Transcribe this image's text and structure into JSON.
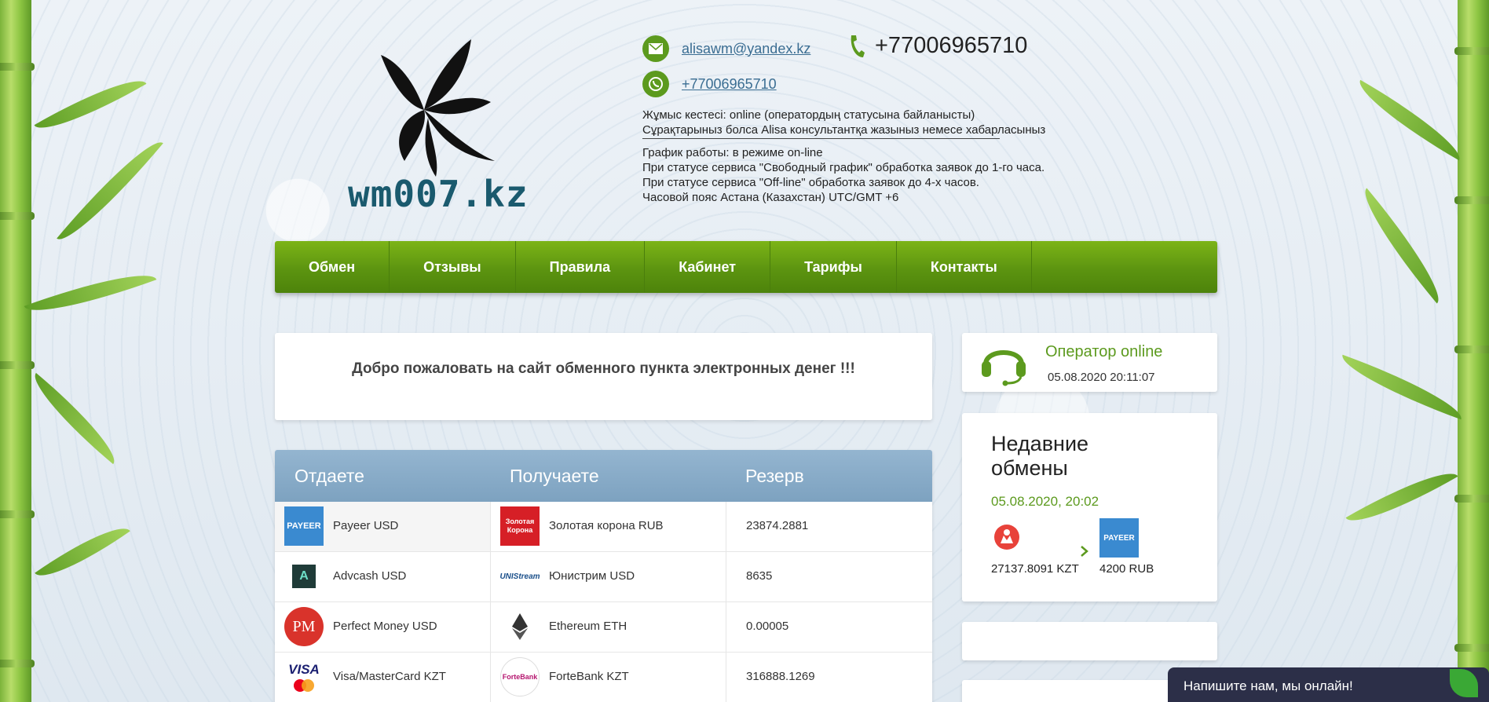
{
  "site": {
    "logo_text": "wm007.kz",
    "email": "alisawm@yandex.kz",
    "phone_big": "+77006965710",
    "whatsapp": "+77006965710"
  },
  "info": {
    "kz_line1": "Жұмыс кестесі: online (оператордың статусына байланысты)",
    "kz_line2": "Сұрақтарыныз болса Alisa консультантқа жазыныз немесе хабарласыныз",
    "ru_line1": "График работы: в режиме on-line",
    "ru_line2": "При статусе сервиса \"Свободный график\" обработка заявок до 1-го часа.",
    "ru_line3": "При статусе сервиса \"Off-line\" обработка заявок до 4-х часов.",
    "ru_line4": "Часовой пояс Астана (Казахстан) UTC/GMT +6"
  },
  "nav": {
    "items": [
      {
        "label": "Обмен"
      },
      {
        "label": "Отзывы"
      },
      {
        "label": "Правила"
      },
      {
        "label": "Кабинет"
      },
      {
        "label": "Тарифы"
      },
      {
        "label": "Контакты"
      }
    ]
  },
  "welcome": {
    "text": "Добро пожаловать на сайт обменного пункта электронных денег !!!"
  },
  "operator": {
    "status": "Оператор online",
    "time": "05.08.2020 20:11:07"
  },
  "recent": {
    "title": "Недавние обмены",
    "date": "05.08.2020, 20:02",
    "from_amount": "27137.8091 KZT",
    "to_amount": "4200 RUB"
  },
  "table": {
    "headers": {
      "give": "Отдаете",
      "get": "Получаете",
      "reserve": "Резерв"
    },
    "rows": [
      {
        "give": "Payeer USD",
        "give_icon": "payeer-icon",
        "get": "Золотая корона RUB",
        "get_icon": "zolotaya-korona-icon",
        "reserve": "23874.2881"
      },
      {
        "give": "Advcash USD",
        "give_icon": "advcash-icon",
        "get": "Юнистрим USD",
        "get_icon": "unistream-icon",
        "reserve": "8635"
      },
      {
        "give": "Perfect Money USD",
        "give_icon": "perfect-money-icon",
        "get": "Ethereum ETH",
        "get_icon": "ethereum-icon",
        "reserve": "0.00005"
      },
      {
        "give": "Visa/MasterCard KZT",
        "give_icon": "visa-mastercard-icon",
        "get": "ForteBank KZT",
        "get_icon": "fortebank-icon",
        "reserve": "316888.1269"
      }
    ],
    "icon_text": {
      "payeer": "PAYEER",
      "korona": "Золотая Корона",
      "advcash": "A",
      "unistream": "UNIStream",
      "pm": "PM",
      "visa": "VISA",
      "forte": "ForteBank"
    }
  },
  "chat": {
    "label": "Напишите нам, мы онлайн!"
  },
  "colors": {
    "accent_green": "#5c9a1e",
    "table_header": "#7da2c0",
    "chat_bg": "#2c2f48"
  }
}
